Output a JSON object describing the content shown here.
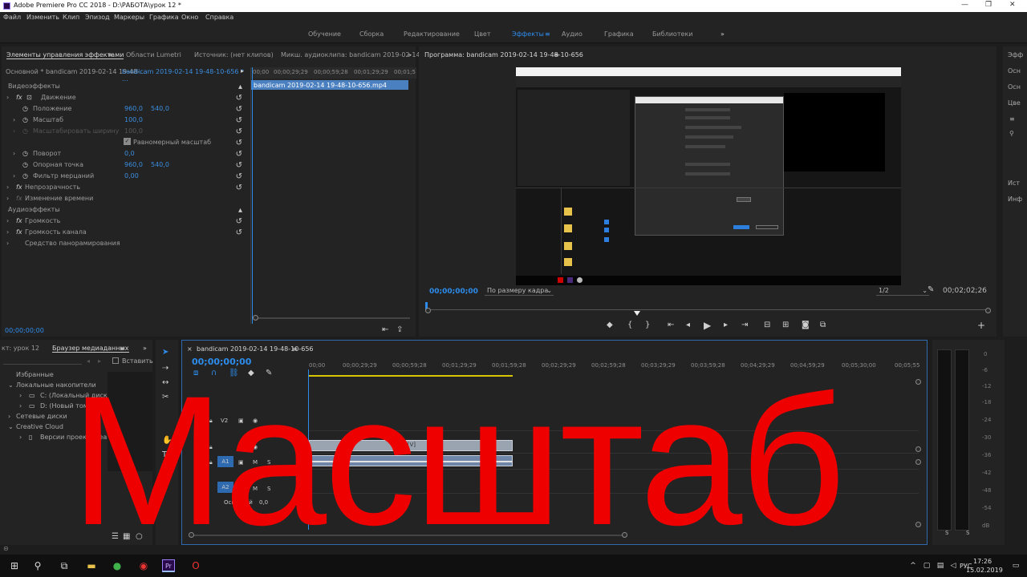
{
  "title_bar": {
    "title": "Adobe Premiere Pro CC 2018 - D:\\РАБОТА\\урок 12 *",
    "minimize": "—",
    "maximize": "❐",
    "close": "✕"
  },
  "menu": [
    "Файл",
    "Изменить",
    "Клип",
    "Эпизод",
    "Маркеры",
    "Графика",
    "Окно",
    "Справка"
  ],
  "workspaces": {
    "items": [
      "Обучение",
      "Сборка",
      "Редактирование",
      "Цвет",
      "Эффекты",
      "Аудио",
      "Графика",
      "Библиотеки"
    ],
    "active": "Эффекты",
    "more": "»"
  },
  "effect_controls": {
    "tabs": [
      "Элементы управления эффектами",
      "Области Lumetri",
      "Источник: (нет клипов)",
      "Микш. аудиоклипа: bandicam 2019-02-14"
    ],
    "master": "Основной * bandicam 2019-02-14 19-48-...",
    "clip": "bandicam 2019-02-14 19-48-10-656 * ...",
    "video_effects": "Видеоэффекты",
    "motion": "Движение",
    "position": {
      "label": "Положение",
      "x": "960,0",
      "y": "540,0"
    },
    "scale": {
      "label": "Масштаб",
      "value": "100,0"
    },
    "scale_width": {
      "label": "Масштабировать ширину",
      "value": "100,0"
    },
    "uniform_scale": "Равномерный масштаб",
    "rotation": {
      "label": "Поворот",
      "value": "0,0"
    },
    "anchor": {
      "label": "Опорная точка",
      "x": "960,0",
      "y": "540,0"
    },
    "flicker": {
      "label": "Фильтр мерцаний",
      "value": "0,00"
    },
    "opacity": "Непрозрачность",
    "time_remap": "Изменение времени",
    "audio_effects": "Аудиоэффекты",
    "volume": "Громкость",
    "channel_volume": "Громкость канала",
    "panner": "Средство панорамирования",
    "timecode": "00;00;00;00",
    "mini_ruler": [
      "00;00",
      "00;00;29;29",
      "00;00;59;28",
      "00;01;29;29",
      "00;01;5"
    ],
    "mini_clip": "bandicam 2019-02-14 19-48-10-656.mp4"
  },
  "program": {
    "title": "Программа: bandicam 2019-02-14 19-48-10-656",
    "menu": "≡",
    "timecode": "00;00;00;00",
    "fit": "По размеру кадра",
    "res": "1/2",
    "duration": "00;02;02;26"
  },
  "media_browser": {
    "project_tab": "кт: урок 12",
    "tab": "Браузер медиаданных",
    "import": "Вставить",
    "favorites": "Избранные",
    "local": "Локальные накопители",
    "c": "C: (Локальный диск)",
    "d": "D: (Новый том)",
    "network": "Сетевые диски",
    "cc": "Creative Cloud",
    "versions": "Версии проекта Team Projects"
  },
  "timeline": {
    "tab": "bandicam 2019-02-14 19-48-10-656",
    "timecode": "00;00;00;00",
    "ruler": [
      "00;00",
      "00;00;29;29",
      "00;00;59;28",
      "00;01;29;29",
      "00;01;59;28",
      "00;02;29;29",
      "00;02;59;28",
      "00;03;29;29",
      "00;03;59;28",
      "00;04;29;29",
      "00;04;59;29",
      "00;05;30;00",
      "00;05;55"
    ],
    "tracks": {
      "v2": "V2",
      "v1": "V1",
      "a1": "A1",
      "a2": "A2",
      "m": "M",
      "s": "S",
      "master": "Основной",
      "master_val": "0,0"
    },
    "clip_label": "[V]"
  },
  "meter": {
    "scale": [
      "0",
      "-6",
      "-12",
      "-18",
      "-24",
      "-30",
      "-36",
      "-42",
      "-48",
      "-54",
      "dB"
    ],
    "s": "S"
  },
  "right_tabs": [
    "Эфф",
    "Осн",
    "Осн",
    "Цве",
    "≡",
    "⚲",
    "Ист",
    "Инф"
  ],
  "overlay_text": "Масштаб",
  "taskbar": {
    "lang": "РУС",
    "time": "17:26",
    "date": "15.02.2019"
  }
}
